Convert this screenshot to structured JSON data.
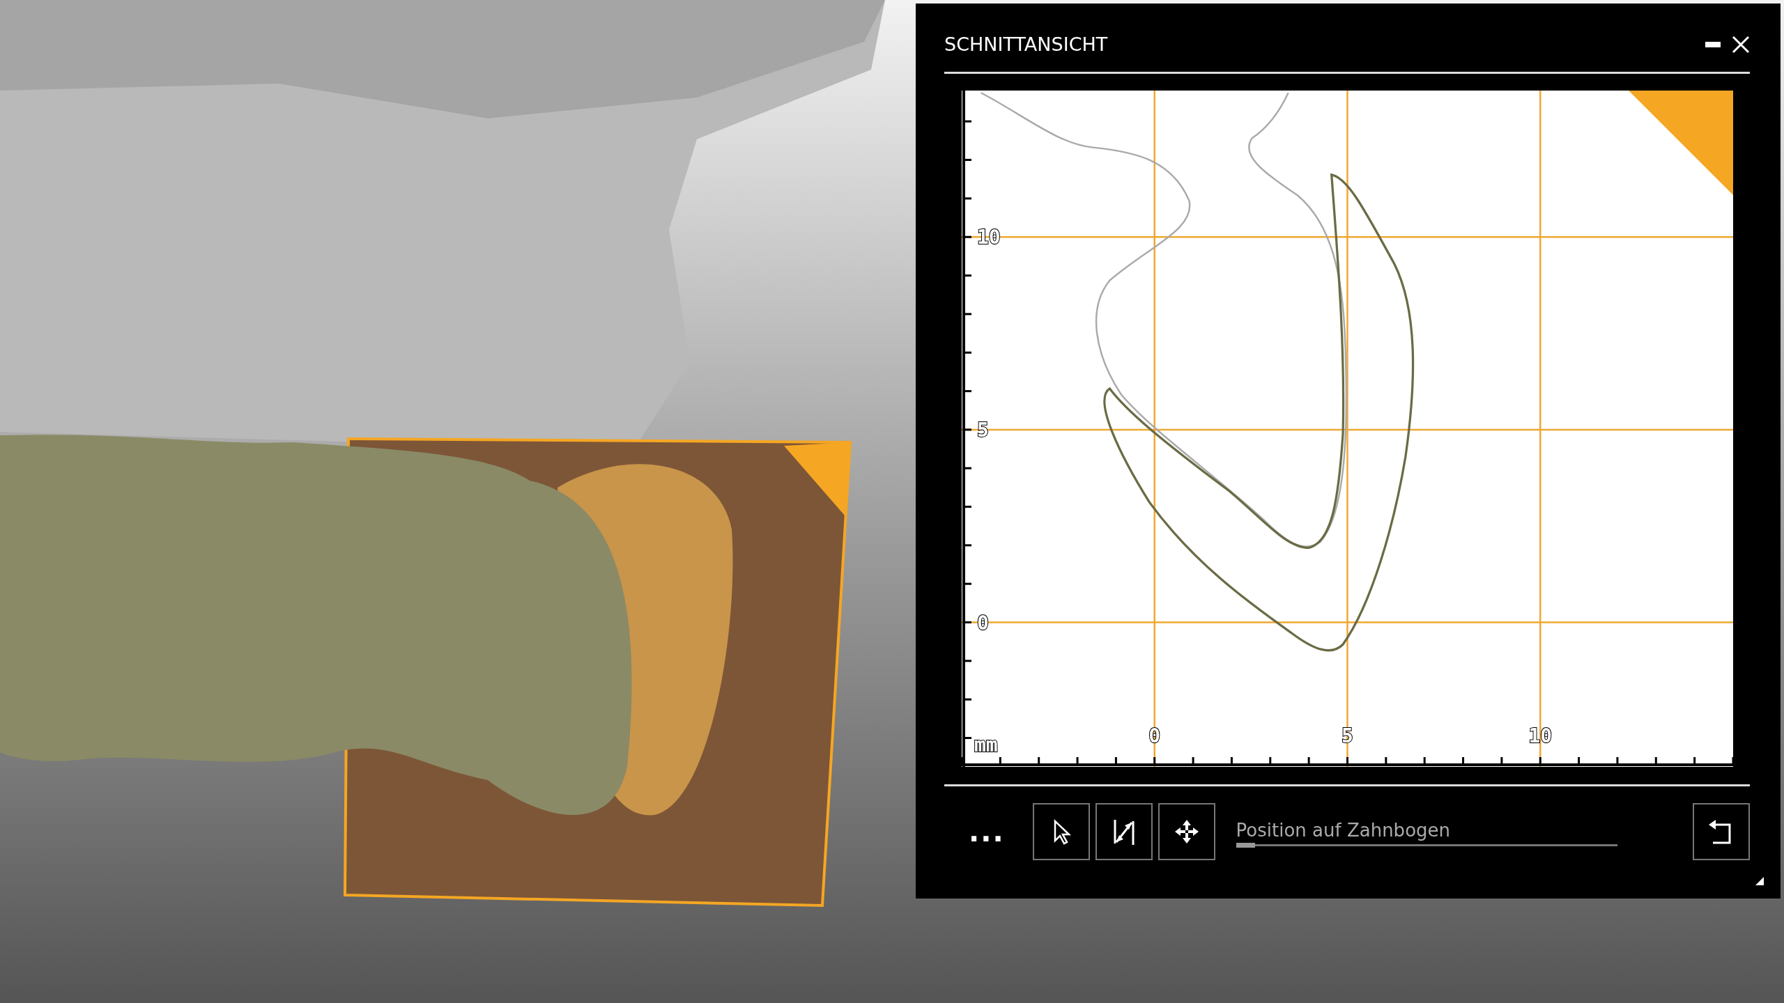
{
  "panel": {
    "title": "SCHNITTANSICHT",
    "chart_data": {
      "type": "line",
      "xlabel": "mm",
      "xlim": [
        -5,
        15
      ],
      "ylim": [
        -3.75,
        13.8
      ],
      "xticks": [
        0,
        5,
        10
      ],
      "yticks": [
        0,
        5,
        10
      ],
      "grid": true
    },
    "toolbar": {
      "more": "...",
      "tools": [
        {
          "kind": "pointer"
        },
        {
          "kind": "measure"
        },
        {
          "kind": "move"
        }
      ],
      "slider": {
        "label": "Position auf Zahnbogen",
        "level": 0.05
      }
    }
  }
}
